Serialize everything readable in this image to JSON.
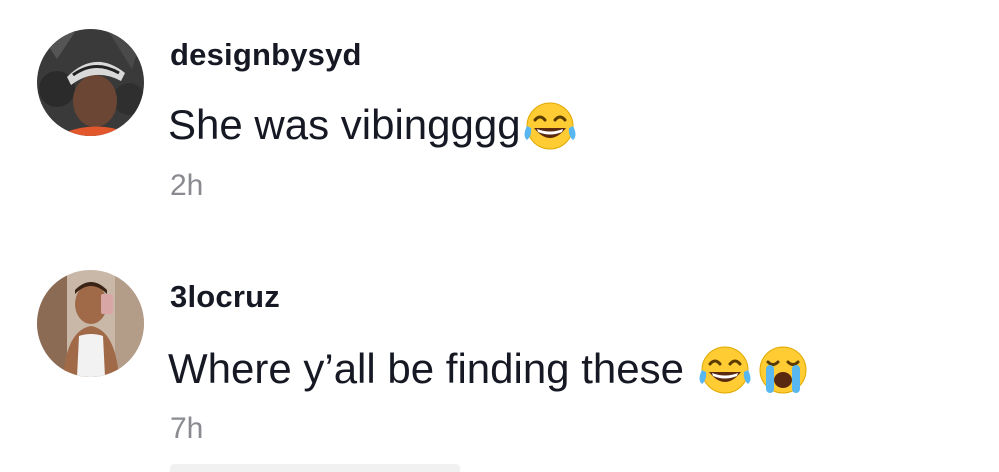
{
  "comments": [
    {
      "username": "designbysyd",
      "text": "She was vibingggg",
      "emojis": [
        "face-with-tears-of-joy"
      ],
      "timestamp": "2h"
    },
    {
      "username": "3locruz",
      "text": "Where y’all be finding these",
      "emojis": [
        "face-with-tears-of-joy",
        "loudly-crying-face"
      ],
      "timestamp": "7h"
    }
  ],
  "colors": {
    "username": "#161823",
    "text": "#161823",
    "timestamp": "#8a8b91",
    "background": "#ffffff"
  }
}
